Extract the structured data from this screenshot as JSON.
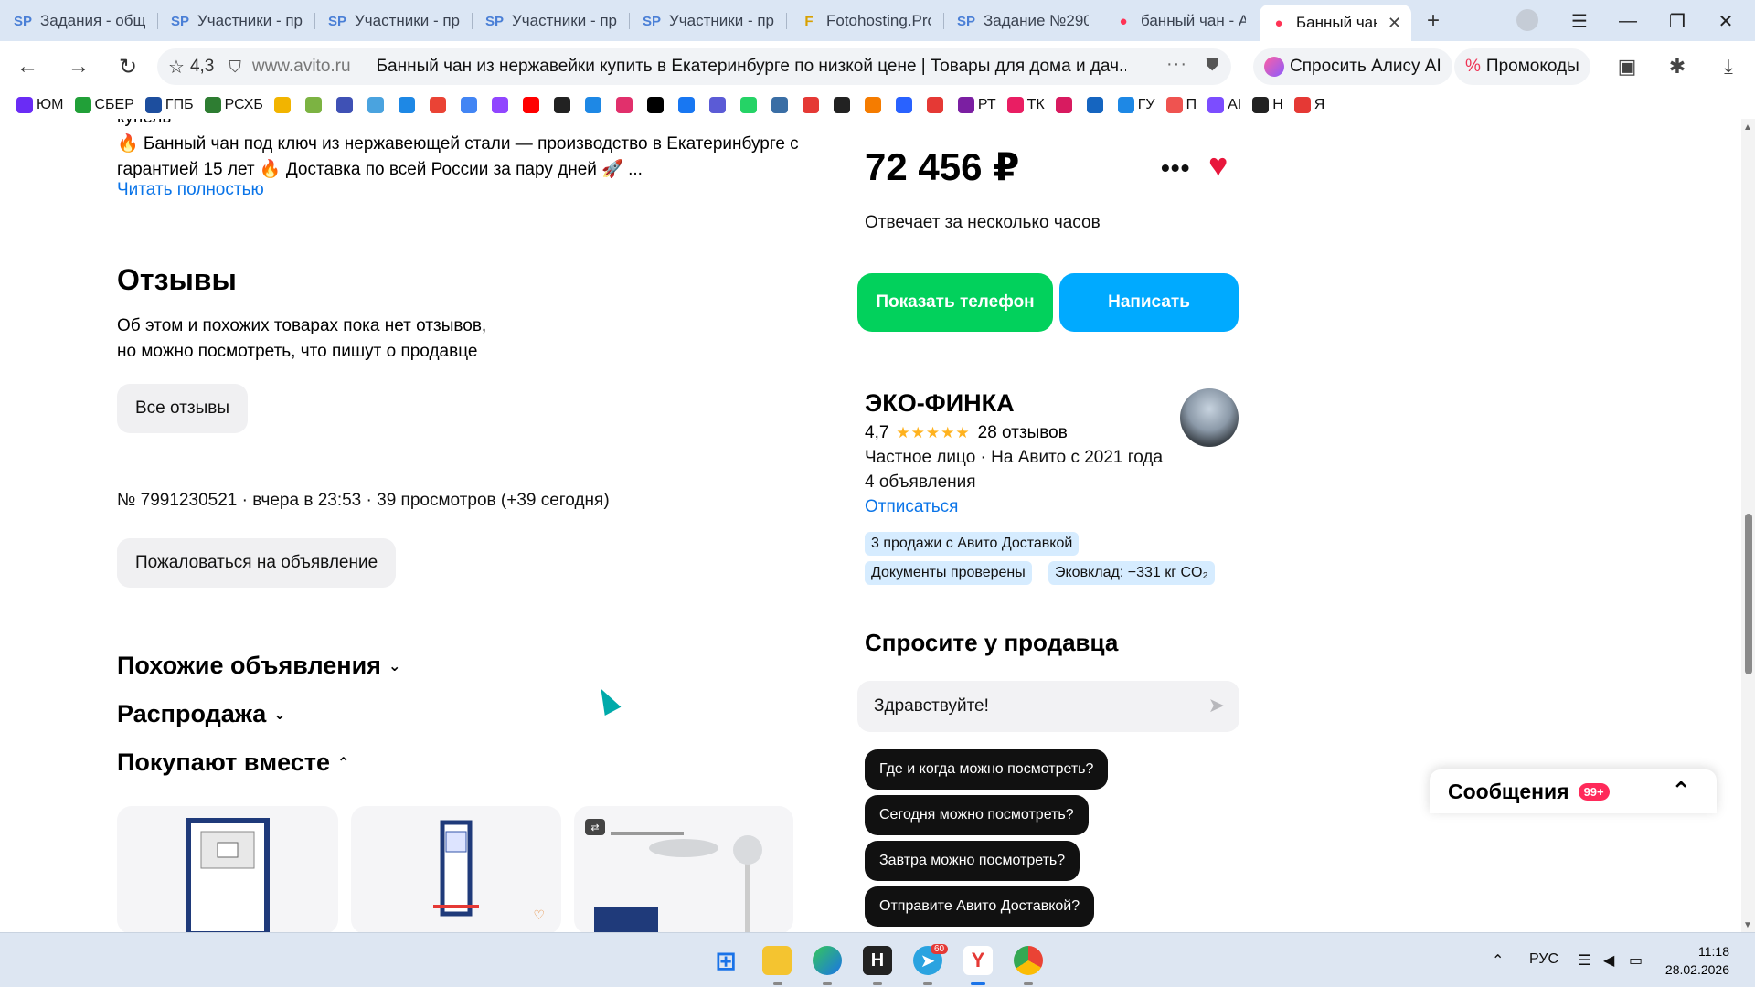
{
  "browser": {
    "tabs": [
      {
        "icon": "SP",
        "title": "Задания - общ",
        "active": false
      },
      {
        "icon": "SP",
        "title": "Участники - пр",
        "active": false
      },
      {
        "icon": "SP",
        "title": "Участники - пр",
        "active": false
      },
      {
        "icon": "SP",
        "title": "Участники - пр",
        "active": false
      },
      {
        "icon": "SP",
        "title": "Участники - пр",
        "active": false
      },
      {
        "icon": "F",
        "title": "Fotohosting.Pro",
        "active": false
      },
      {
        "icon": "SP",
        "title": "Задание №290",
        "active": false
      },
      {
        "icon": "●",
        "title": "банный чан - А",
        "active": false
      },
      {
        "icon": "●",
        "title": "Банный чан",
        "active": true
      }
    ],
    "address": {
      "rating": "4,3",
      "domain": "www.avito.ru",
      "page_title": "Банный чан из нержавейки купить в Екатеринбурге по низкой цене | Товары для дома и дач..."
    },
    "alice_label": "Спросить Алису AI",
    "promo_label": "Промокоды",
    "bookmarks": [
      {
        "label": "ЮМ",
        "color": "#6a2cf5"
      },
      {
        "label": "СБЕР",
        "color": "#21a038"
      },
      {
        "label": "ГПБ",
        "color": "#1d4e9e"
      },
      {
        "label": "РСХБ",
        "color": "#2e7d32"
      },
      {
        "label": "",
        "color": "#f2b400"
      },
      {
        "label": "",
        "color": "#7cb342"
      },
      {
        "label": "",
        "color": "#3f51b5"
      },
      {
        "label": "",
        "color": "#4aa3df"
      },
      {
        "label": "",
        "color": "#1e88e5"
      },
      {
        "label": "",
        "color": "#ea4335"
      },
      {
        "label": "",
        "color": "#4285f4"
      },
      {
        "label": "",
        "color": "#9146ff"
      },
      {
        "label": "",
        "color": "#ff0000"
      },
      {
        "label": "",
        "color": "#222222"
      },
      {
        "label": "",
        "color": "#1e88e5"
      },
      {
        "label": "",
        "color": "#e1306c"
      },
      {
        "label": "",
        "color": "#000000"
      },
      {
        "label": "",
        "color": "#1877f2"
      },
      {
        "label": "",
        "color": "#5b5bd6"
      },
      {
        "label": "",
        "color": "#25d366"
      },
      {
        "label": "",
        "color": "#3a6ea5"
      },
      {
        "label": "",
        "color": "#e53935"
      },
      {
        "label": "",
        "color": "#222222"
      },
      {
        "label": "",
        "color": "#f57c00"
      },
      {
        "label": "",
        "color": "#2962ff"
      },
      {
        "label": "",
        "color": "#e53935"
      },
      {
        "label": "РТ",
        "color": "#7b1fa2"
      },
      {
        "label": "ТК",
        "color": "#e91e63"
      },
      {
        "label": "",
        "color": "#d81b60"
      },
      {
        "label": "",
        "color": "#1565c0"
      },
      {
        "label": "ГУ",
        "color": "#1e88e5"
      },
      {
        "label": "П",
        "color": "#ef5350"
      },
      {
        "label": "AI",
        "color": "#7c4dff"
      },
      {
        "label": "Н",
        "color": "#222222"
      },
      {
        "label": "Я",
        "color": "#e53935"
      }
    ]
  },
  "listing": {
    "cut_text": "купель",
    "description": "🔥 Банный чан под ключ из нержавеющей стали — производство в Екатеринбурге с гарантией 15 лет 🔥 Доставка по всей России за пару дней 🚀 ...",
    "read_more": "Читать полностью",
    "reviews_title": "Отзывы",
    "reviews_text_1": "Об этом и похожих товарах пока нет отзывов,",
    "reviews_text_2": "но можно посмотреть, что пишут о продавце",
    "all_reviews_btn": "Все отзывы",
    "meta": "№ 7991230521 · вчера в 23:53 · 39 просмотров (+39 сегодня)",
    "report_btn": "Пожаловаться на объявление",
    "similar": "Похожие объявления",
    "sale": "Распродажа",
    "bought_together": "Покупают вместе"
  },
  "sidebar": {
    "price": "72 456 ₽",
    "answers": "Отвечает за несколько часов",
    "show_phone": "Показать телефон",
    "write": "Написать",
    "seller_name": "ЭКО-ФИНКА",
    "seller_rating": "4,7",
    "seller_stars": "★★★★★",
    "seller_reviews": "28 отзывов",
    "seller_type": "Частное лицо · На Авито с 2021 года",
    "seller_ads": "4 объявления",
    "unsubscribe": "Отписаться",
    "tags": [
      "3 продажи с Авито Доставкой",
      "Документы проверены",
      "Эковклад: −331 кг CO₂"
    ],
    "ask_title": "Спросите у продавца",
    "ask_input": "Здравствуйте!",
    "questions": [
      "Где и когда можно посмотреть?",
      "Сегодня можно посмотреть?",
      "Завтра можно посмотреть?",
      "Отправите Авито Доставкой?"
    ]
  },
  "messages": {
    "label": "Сообщения",
    "badge": "99+"
  },
  "taskbar": {
    "lang": "РУС",
    "time": "11:18",
    "date": "28.02.2026",
    "telegram_badge": "60"
  },
  "colors": {
    "green": "#02d15c",
    "blue": "#00aaff",
    "link": "#0a74e8",
    "heart": "#e8173c"
  }
}
